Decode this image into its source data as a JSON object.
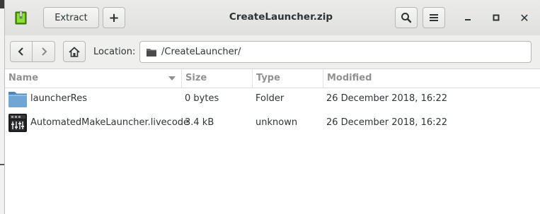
{
  "window": {
    "title": "CreateLauncher.zip"
  },
  "headerbar": {
    "app_icon": "archive-manager-icon",
    "extract_label": "Extract",
    "add_label": "+",
    "search_icon": "search-icon",
    "menu_icon": "hamburger-menu-icon",
    "minimize_icon": "minimize-icon",
    "maximize_icon": "maximize-icon",
    "close_label": "✕"
  },
  "locationbar": {
    "back_icon": "chevron-left-icon",
    "forward_icon": "chevron-right-icon",
    "home_icon": "home-icon",
    "label": "Location:",
    "path": "/CreateLauncher/"
  },
  "columns": {
    "name": "Name",
    "size": "Size",
    "type": "Type",
    "modified": "Modified"
  },
  "files": [
    {
      "name": "launcherRes",
      "size": "0 bytes",
      "type": "Folder",
      "modified": "26 December 2018, 16:22",
      "icon": "folder-icon"
    },
    {
      "name": "AutomatedMakeLauncher.livecode",
      "size": "3.4 kB",
      "type": "unknown",
      "modified": "26 December 2018, 16:22",
      "icon": "livecode-file-icon"
    }
  ],
  "colors": {
    "folder": "#6ea6d6",
    "header_text": "#919190"
  }
}
